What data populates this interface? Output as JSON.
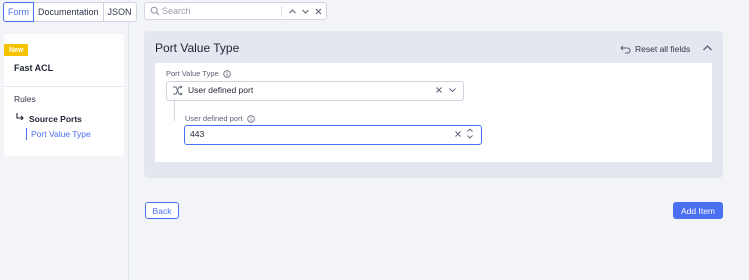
{
  "view_tabs": {
    "form": "Form",
    "documentation": "Documentation",
    "json": "JSON",
    "active": "Form"
  },
  "search": {
    "placeholder": "Search",
    "value": ""
  },
  "sidebar": {
    "badge": "New",
    "title": "Fast ACL",
    "items": [
      {
        "label": "Rules"
      },
      {
        "label": "Source Ports"
      },
      {
        "label": "Port Value Type"
      }
    ]
  },
  "section": {
    "title": "Port Value Type",
    "reset_label": "Reset all fields",
    "port_value_type": {
      "label": "Port Value Type",
      "selected": "User defined port"
    },
    "user_defined_port": {
      "label": "User defined port",
      "value": "443"
    }
  },
  "footer": {
    "back_label": "Back",
    "add_label": "Add Item"
  },
  "colors": {
    "accent": "#4a6ff0",
    "badge": "#f5c200",
    "background": "#f3f4f7",
    "section": "#e4e7f0"
  }
}
